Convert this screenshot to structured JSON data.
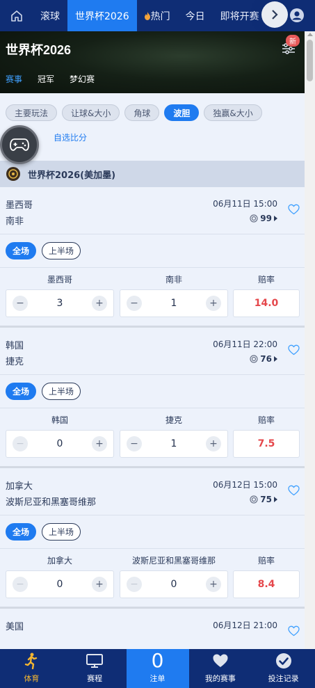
{
  "topnav": {
    "tabs": [
      {
        "label": "滚球",
        "active": false
      },
      {
        "label": "世界杯2026",
        "active": true
      },
      {
        "label": "热门",
        "active": false
      },
      {
        "label": "今日",
        "active": false
      },
      {
        "label": "即将开赛",
        "active": false
      }
    ],
    "home_icon": "home-icon",
    "more_icon": "chevron-right-icon",
    "user_icon": "user-icon"
  },
  "banner": {
    "title": "世界杯2026",
    "new_badge": "新",
    "subtabs": [
      {
        "label": "赛事",
        "active": true
      },
      {
        "label": "冠军",
        "active": false
      },
      {
        "label": "梦幻赛",
        "active": false
      }
    ]
  },
  "filters": {
    "pills": [
      {
        "label": "主要玩法",
        "active": false
      },
      {
        "label": "让球&大小",
        "active": false
      },
      {
        "label": "角球",
        "active": false
      },
      {
        "label": "波胆",
        "active": true
      },
      {
        "label": "独赢&大小",
        "active": false
      }
    ],
    "custom_score": "自选比分"
  },
  "league": {
    "name": "世界杯2026(美加墨)"
  },
  "matches": [
    {
      "home": "墨西哥",
      "away": "南非",
      "time": "06月11日 15:00",
      "count": "99",
      "periods": [
        "全场",
        "上半场"
      ],
      "columns": {
        "home": "墨西哥",
        "away": "南非",
        "odds": "赔率"
      },
      "home_score": "3",
      "away_score": "1",
      "odds": "14.0"
    },
    {
      "home": "韩国",
      "away": "捷克",
      "time": "06月11日 22:00",
      "count": "76",
      "periods": [
        "全场",
        "上半场"
      ],
      "columns": {
        "home": "韩国",
        "away": "捷克",
        "odds": "赔率"
      },
      "home_score": "0",
      "away_score": "1",
      "odds": "7.5"
    },
    {
      "home": "加拿大",
      "away": "波斯尼亚和黑塞哥维那",
      "time": "06月12日 15:00",
      "count": "75",
      "periods": [
        "全场",
        "上半场"
      ],
      "columns": {
        "home": "加拿大",
        "away": "波斯尼亚和黑塞哥维那",
        "odds": "赔率"
      },
      "home_score": "0",
      "away_score": "0",
      "odds": "8.4"
    },
    {
      "home": "美国",
      "time": "06月12日 21:00"
    }
  ],
  "bottomnav": [
    {
      "label": "体育",
      "icon": "sports-runner-icon",
      "active": true
    },
    {
      "label": "赛程",
      "icon": "monitor-icon",
      "active": false
    },
    {
      "label": "注单",
      "count": "0",
      "active": false
    },
    {
      "label": "我的赛事",
      "icon": "heart-icon",
      "active": false
    },
    {
      "label": "投注记录",
      "icon": "check-circle-icon",
      "active": false
    }
  ],
  "colors": {
    "nav": "#0f2d75",
    "accent": "#1f7bf0",
    "odds": "#e5474b",
    "active_bottom": "#f2b532"
  }
}
